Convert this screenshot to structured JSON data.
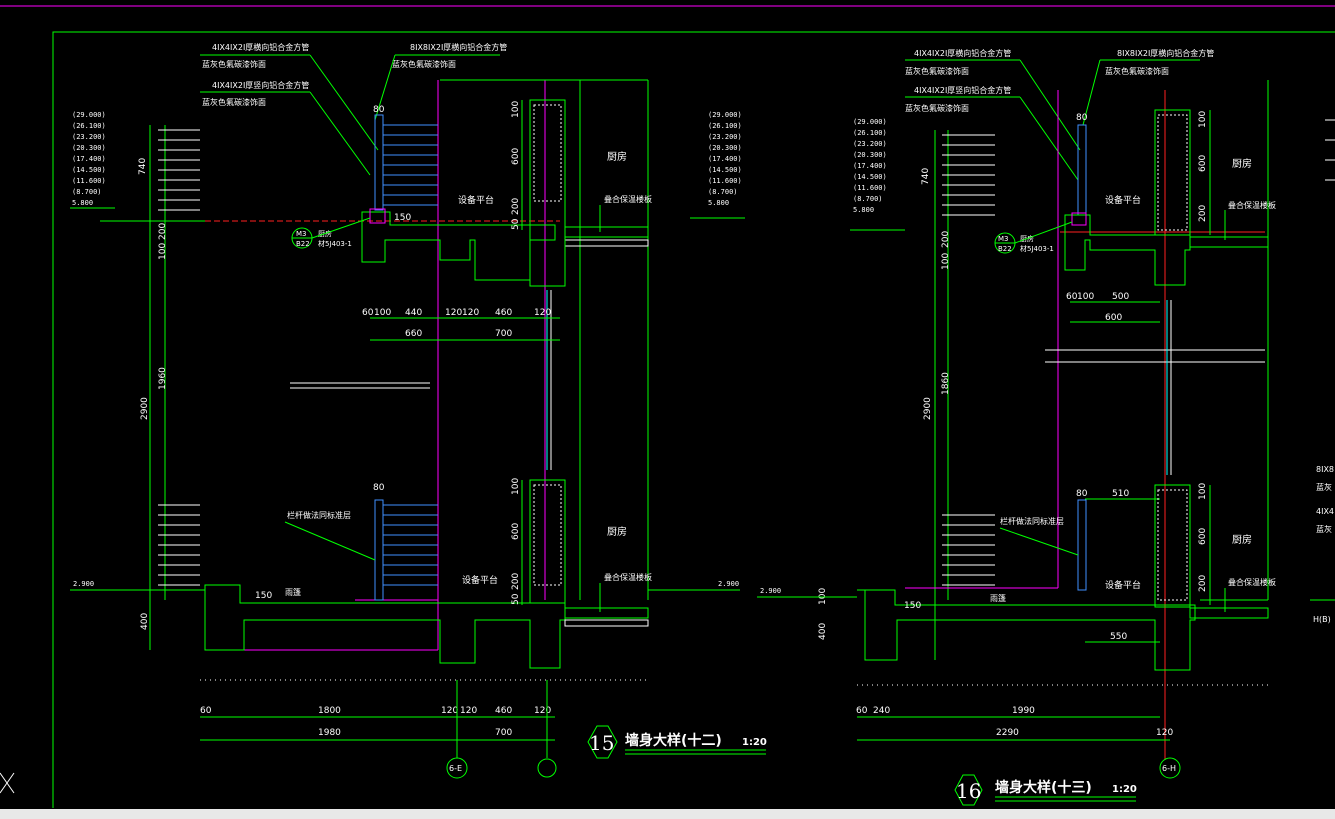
{
  "colors": {
    "background": "#000000",
    "green": "#00ff00",
    "cyan": "#00ffff",
    "magenta": "#ff00ff",
    "red": "#ff2020",
    "white": "#ffffff",
    "blue": "#4090ff"
  },
  "left": {
    "notes": [
      "4IX4IX2I厚横向铝合金方管",
      "蓝灰色氟碳漆饰面",
      "4IX4IX2I厚竖向铝合金方管",
      "蓝灰色氟碳漆饰面",
      "8IX8IX2I厚横向铝合金方管",
      "蓝灰色氟碳漆饰面"
    ],
    "levels": [
      "(29.000)",
      "(26.100)",
      "(23.200)",
      "(20.300)",
      "(17.400)",
      "(14.500)",
      "(11.600)",
      "(8.700)",
      "5.800"
    ],
    "levels_right": [
      "(29.000)",
      "(26.100)",
      "(23.200)",
      "(20.300)",
      "(17.400)",
      "(14.500)",
      "(11.600)",
      "(8.700)",
      "5.800"
    ],
    "room_upper": "厨房",
    "room_lower": "厨房",
    "platform_upper": "设备平台",
    "platform_lower": "设备平台",
    "insul_upper": "叠合保温楼板",
    "insul_lower": "叠合保温楼板",
    "railing": "栏杆做法同标准层",
    "canopy": "雨篷",
    "ref_callout": "M3 B22",
    "ref_note": "厨房 材5J403-1",
    "level_bottom": "2.900",
    "level_bottom_right": "2.900",
    "vert_dims": [
      "740",
      "200",
      "100",
      "1960",
      "2900",
      "400"
    ],
    "side_dims": [
      "100",
      "600",
      "200",
      "50",
      "100",
      "600",
      "200",
      "50"
    ],
    "dim_80_top": "80",
    "dim_80_mid": "80",
    "dim_150_a": "150",
    "dim_150_b": "150",
    "mid_dims": [
      "60",
      "100",
      "440",
      "120",
      "120",
      "460",
      "120"
    ],
    "mid_totals": [
      "660",
      "700"
    ],
    "bottom_dims": [
      "60",
      "1800",
      "120",
      "120",
      "460",
      "120"
    ],
    "bottom_totals": [
      "1980",
      "700"
    ],
    "axis_label": "6-E",
    "detail_number": "15",
    "title": "墙身大样(十二)",
    "scale": "1:20"
  },
  "right": {
    "notes": [
      "4IX4IX2I厚横向铝合金方管",
      "蓝灰色氟碳漆饰面",
      "4IX4IX2I厚竖向铝合金方管",
      "蓝灰色氟碳漆饰面",
      "8IX8IX2I厚横向铝合金方管",
      "蓝灰色氟碳漆饰面"
    ],
    "levels": [
      "(29.000)",
      "(26.100)",
      "(23.200)",
      "(20.300)",
      "(17.400)",
      "(14.500)",
      "(11.600)",
      "(8.700)",
      "5.800"
    ],
    "room_upper": "厨房",
    "room_lower": "厨房",
    "platform_upper": "设备平台",
    "platform_lower": "设备平台",
    "insul_upper": "叠合保温楼板",
    "insul_lower": "叠合保温楼板",
    "railing": "栏杆做法同标准层",
    "canopy": "雨篷",
    "ref_callout": "M3 B22",
    "ref_note": "厨房 材5J403-1",
    "level_bottom": "2.900",
    "vert_dims": [
      "740",
      "200",
      "100",
      "1860",
      "2900",
      "100",
      "400"
    ],
    "side_dims": [
      "100",
      "600",
      "200",
      "100",
      "600",
      "200"
    ],
    "dim_80_top": "80",
    "dim_80_mid": "80",
    "dim_510": "510",
    "dim_150": "150",
    "mid_dims": [
      "60",
      "100",
      "500"
    ],
    "mid_total": "600",
    "dim_550": "550",
    "bottom_dims": [
      "60",
      "240",
      "1990"
    ],
    "bottom_total": "2290",
    "dim_120": "120",
    "axis_label": "6-H",
    "detail_number": "16",
    "title": "墙身大样(十三)",
    "scale": "1:20",
    "edge_labels": [
      "8IX8",
      "蓝灰",
      "4IX4",
      "蓝灰",
      "H(B)"
    ]
  }
}
